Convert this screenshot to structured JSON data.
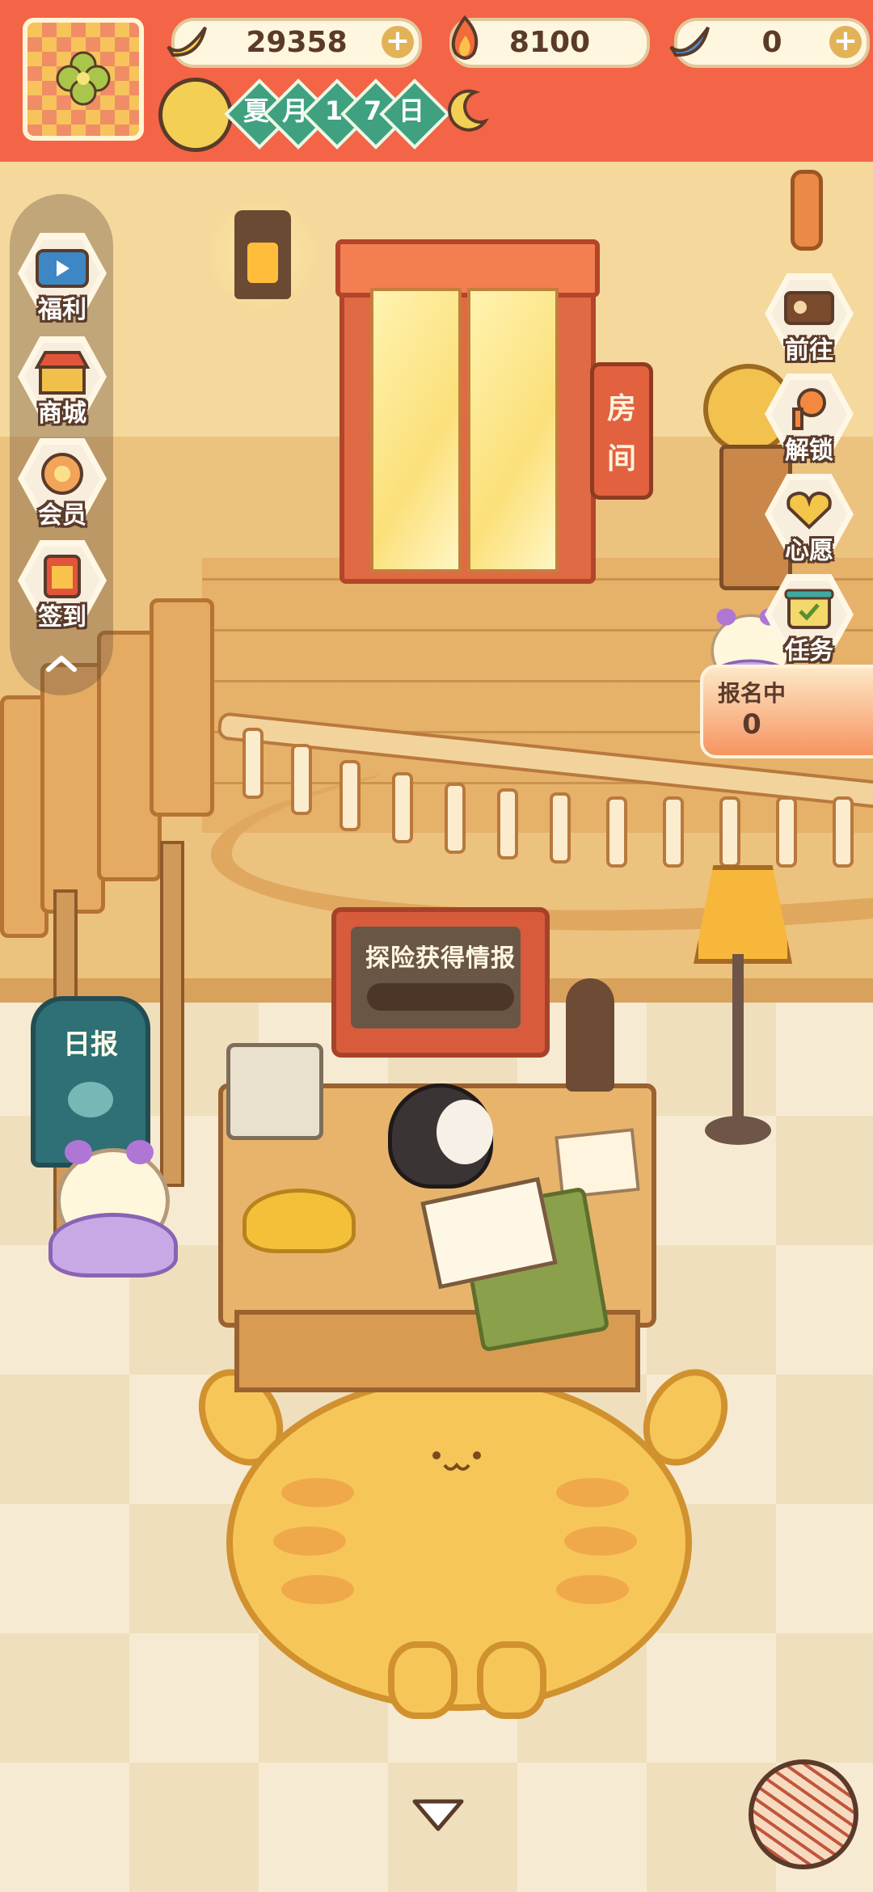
{
  "currencies": [
    {
      "icon": "banana-icon",
      "value": "29358",
      "has_plus": true
    },
    {
      "icon": "flame-icon",
      "value": "8100",
      "has_plus": false
    },
    {
      "icon": "blue-banana-icon",
      "value": "0",
      "has_plus": true
    }
  ],
  "date": {
    "chars": [
      "夏",
      "月",
      "1",
      "7",
      "日"
    ]
  },
  "left_menu": [
    {
      "id": "welfare",
      "label": "福利",
      "icon": "tv-icon"
    },
    {
      "id": "shop",
      "label": "商城",
      "icon": "shop-icon"
    },
    {
      "id": "member",
      "label": "会员",
      "icon": "flower-badge-icon"
    },
    {
      "id": "checkin",
      "label": "签到",
      "icon": "calendar-icon"
    }
  ],
  "right_menu": [
    {
      "id": "goto",
      "label": "前往",
      "icon": "signboard-icon"
    },
    {
      "id": "unlock",
      "label": "解锁",
      "icon": "key-icon"
    },
    {
      "id": "wish",
      "label": "心愿",
      "icon": "heart-book-icon"
    },
    {
      "id": "task",
      "label": "任务",
      "icon": "task-scroll-icon"
    }
  ],
  "signup": {
    "title": "报名中",
    "count": "0"
  },
  "scene": {
    "room_sign": [
      "房",
      "间"
    ],
    "tv_text": "探险获得情报",
    "newspaper_title": "日报"
  },
  "colors": {
    "hud": "#f46447",
    "label_outline": "#5a3b2a",
    "date_green": "#3fa17f"
  }
}
